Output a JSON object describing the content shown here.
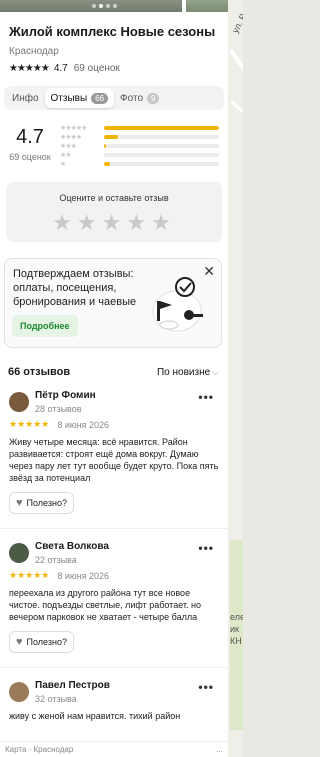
{
  "place": {
    "title": "Жилой комплекс Новые сезоны",
    "city": "Краснодар",
    "rating": "4.7",
    "stars": "★★★★★",
    "reviews_count": "69 оценок"
  },
  "tabs": [
    {
      "label": "Инфо",
      "badge": ""
    },
    {
      "label": "Отзывы",
      "badge": "66"
    },
    {
      "label": "Фото",
      "badge": "9"
    }
  ],
  "summary": {
    "score": "4.7",
    "score_caption": "69 оценок",
    "distribution": [
      {
        "stars": "★★★★★",
        "fraction": 1.0
      },
      {
        "stars": "★★★★",
        "fraction": 0.12
      },
      {
        "stars": "★★★",
        "fraction": 0.02
      },
      {
        "stars": "★★",
        "fraction": 0.0
      },
      {
        "stars": "★",
        "fraction": 0.05
      }
    ]
  },
  "rate_card": {
    "prompt": "Оцените и оставьте отзыв",
    "stars": "★★★★★"
  },
  "promo": {
    "text": "Подтверждаем отзывы: оплаты, посещения, бронирования и чаевые",
    "button": "Подробнее",
    "close_icon": "close-icon"
  },
  "reviews_header": {
    "title": "66 отзывов",
    "sort": "По новизне",
    "sort_icon": "chevron-down-icon"
  },
  "reviews": [
    {
      "name": "Пётр Фомин",
      "count": "28 отзывов",
      "stars": "★★★★★",
      "date": "8 июня 2026",
      "text": "Живу четыре месяца: всё нравится. Район развивается: строят ещё дома вокруг. Думаю через пару лет тут вообще будет круто. Пока пять звёзд за потенциал",
      "helpful": "Полезно?",
      "avatar_color": "#7a5a3c"
    },
    {
      "name": "Света Волкова",
      "count": "22 отзыва",
      "stars": "★★★★★",
      "date": "8 июня 2026",
      "text": "переехала из другого района тут все новое чистое. подъезды светлые, лифт работает. но вечером парковок не хватает - четыре балла",
      "helpful": "Полезно?",
      "avatar_color": "#4c5b45"
    },
    {
      "name": "Павел Пестров",
      "count": "32 отзыва",
      "stars": "",
      "date": "",
      "text": "живу с женой нам нравится. тихий район",
      "helpful": "",
      "avatar_color": "#9a7a58"
    }
  ],
  "footer": {
    "left": "Карта · Краснодар",
    "right": "..."
  },
  "map": {
    "label1": "ул. Ро",
    "label2": "еле",
    "label3": "ик",
    "label4": "КН"
  }
}
